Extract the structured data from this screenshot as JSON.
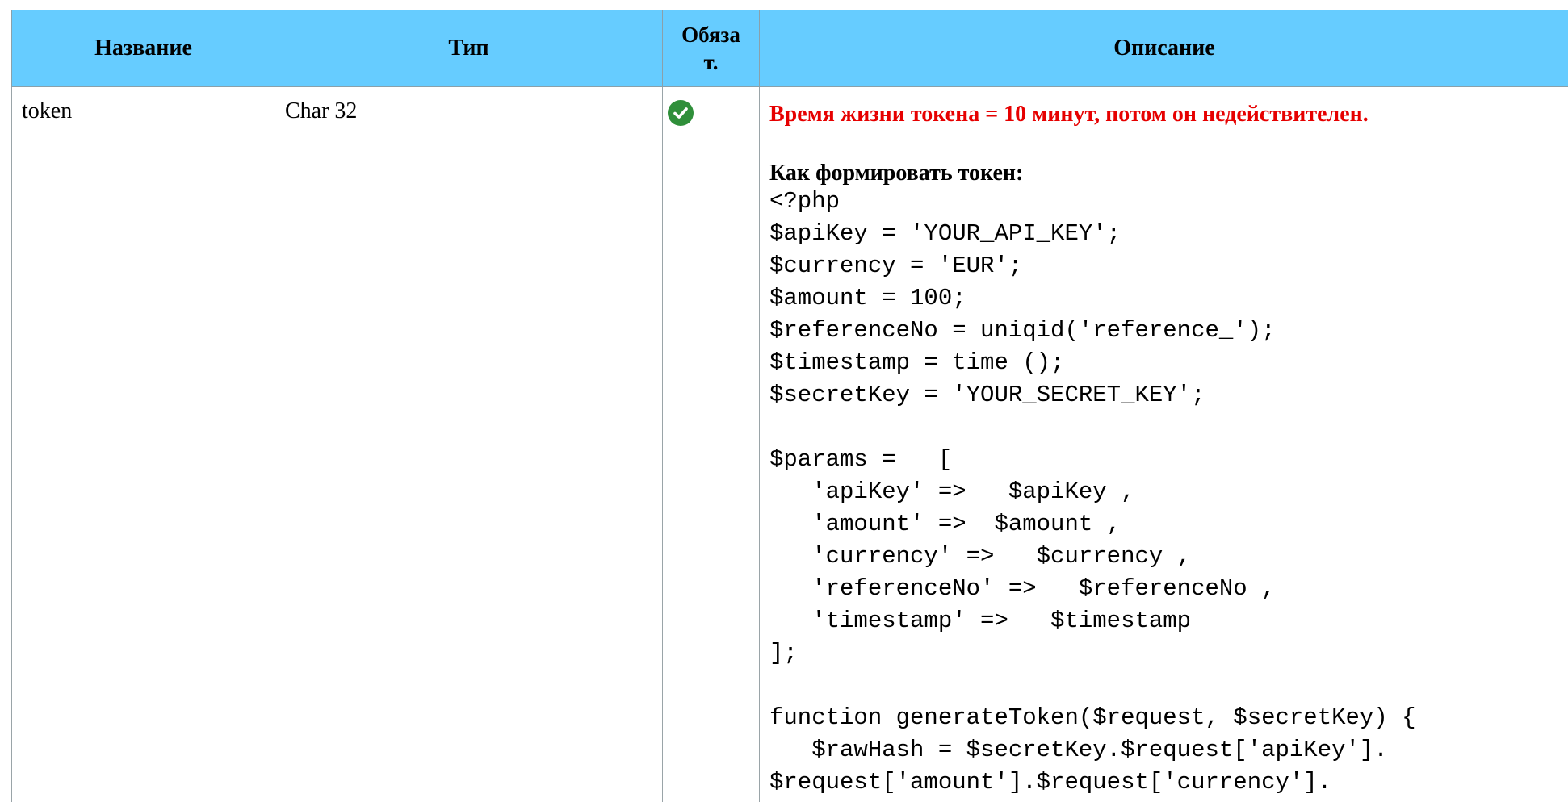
{
  "table": {
    "headers": {
      "name": "Название",
      "type": "Тип",
      "required": "Обяза\nт.",
      "description": "Описание"
    },
    "rows": [
      {
        "name": "token",
        "type": "Char 32",
        "required_icon": "check-circle-icon",
        "description": {
          "warning": "Время жизни токена = 10 минут, потом он недействителен.",
          "howto_title": "Как формировать токен:",
          "code": "<?php\n$apiKey = 'YOUR_API_KEY';\n$currency = 'EUR';\n$amount = 100;\n$referenceNo = uniqid('reference_');\n$timestamp = time ();\n$secretKey = 'YOUR_SECRET_KEY';\n\n$params =   [\n   'apiKey' =>   $apiKey ,\n   'amount' =>  $amount ,\n   'currency' =>   $currency ,\n   'referenceNo' =>   $referenceNo ,\n   'timestamp' =>   $timestamp\n];\n\nfunction generateToken($request, $secretKey) {\n   $rawHash = $secretKey.$request['apiKey'].\n$request['amount'].$request['currency']."
        }
      }
    ]
  },
  "colors": {
    "header_bg": "#66ccff",
    "warning_text": "#e60000",
    "check_icon": "#2f8f3a"
  }
}
